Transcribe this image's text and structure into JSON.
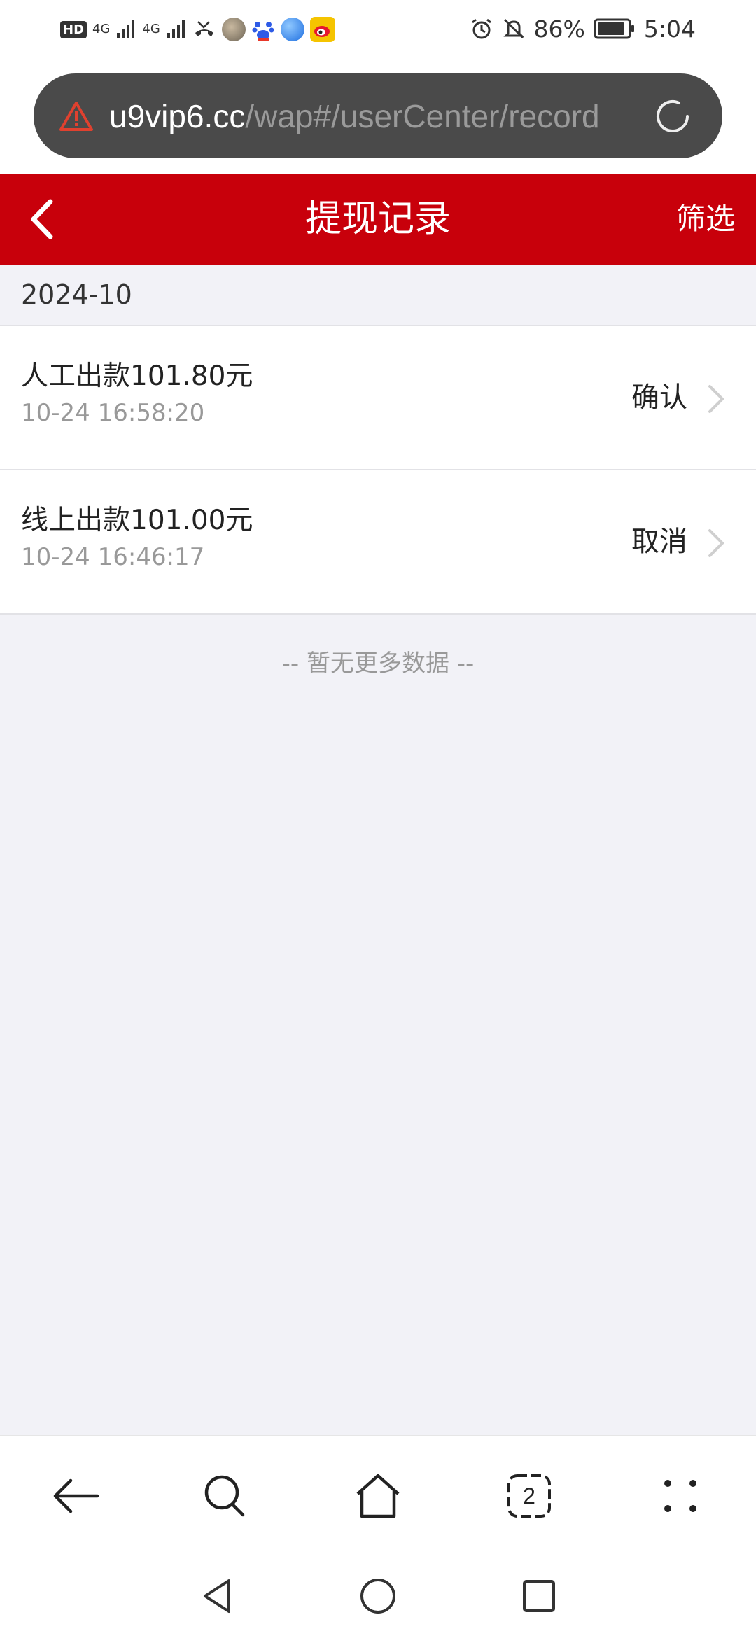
{
  "status_bar": {
    "hd_label": "HD",
    "network_1": "4G",
    "network_2": "4G",
    "alarm_icon": "alarm-icon",
    "bell_icon": "bell-off-icon",
    "battery_percent": "86%",
    "time": "5:04"
  },
  "browser": {
    "url_domain": "u9vip6.cc",
    "url_path": "/wap#/userCenter/record",
    "tab_count": "2"
  },
  "header": {
    "title": "提现记录",
    "filter_label": "筛选"
  },
  "month_label": "2024-10",
  "records": [
    {
      "title": "人工出款101.80元",
      "time": "10-24 16:58:20",
      "status": "确认"
    },
    {
      "title": "线上出款101.00元",
      "time": "10-24 16:46:17",
      "status": "取消"
    }
  ],
  "no_more_text": "-- 暂无更多数据 --",
  "colors": {
    "header_red": "#c8000b",
    "background": "#f2f2f7",
    "warning": "#e0412f"
  }
}
